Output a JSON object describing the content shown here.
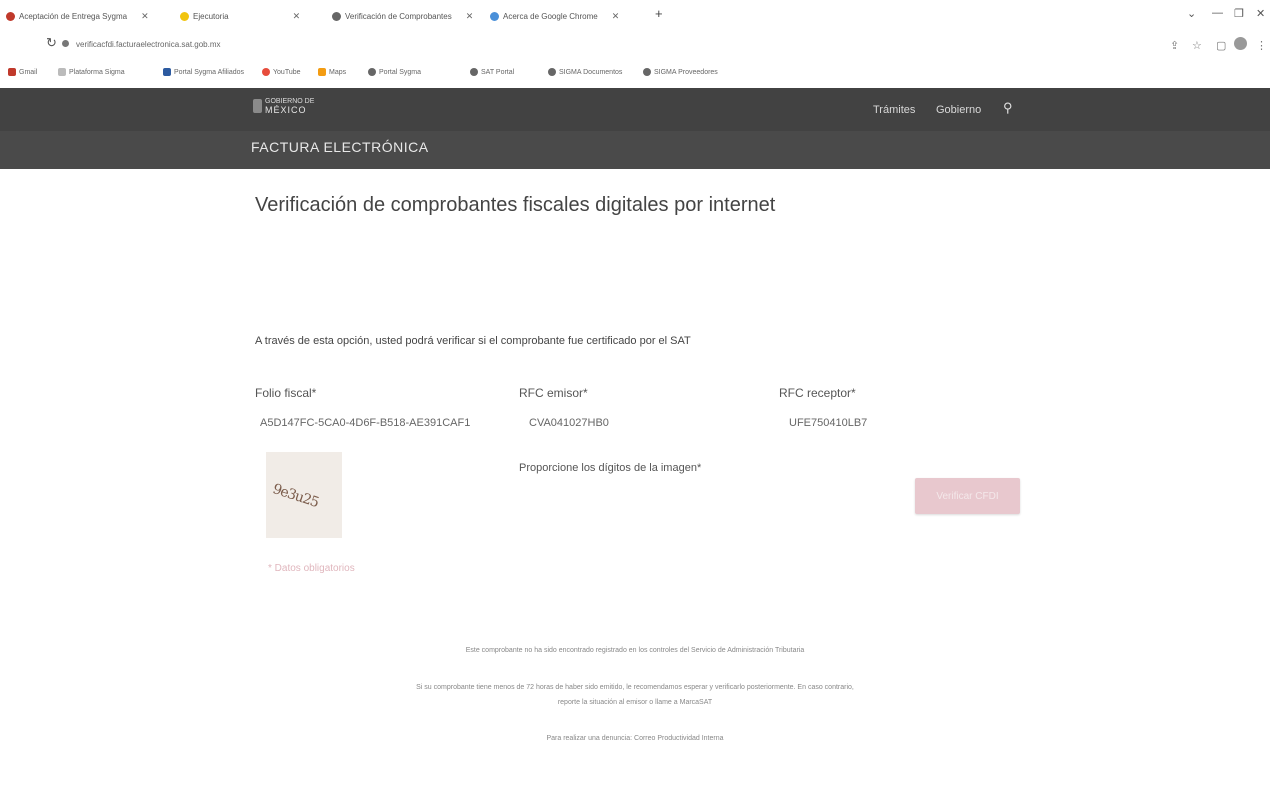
{
  "browser": {
    "tabs": [
      {
        "label": "Aceptación de Entrega Sygma",
        "close": "✕"
      },
      {
        "label": "Ejecutoria",
        "close": "✕"
      },
      {
        "label": "Verificación de Comprobantes",
        "close": "✕"
      },
      {
        "label": "Acerca de Google Chrome",
        "close": "✕"
      }
    ],
    "new_tab": "+",
    "window_controls": [
      "⌄",
      "—",
      "❐",
      "✕"
    ],
    "url": "verificacfdi.facturaelectronica.sat.gob.mx",
    "bookmarks": [
      {
        "label": "Gmail"
      },
      {
        "label": "Plataforma Sigma"
      },
      {
        "label": "Portal Sygma Afiliados"
      },
      {
        "label": "YouTube"
      },
      {
        "label": "Maps"
      },
      {
        "label": "Portal Sygma"
      },
      {
        "label": "SAT Portal"
      },
      {
        "label": "SIGMA Documentos"
      },
      {
        "label": "SIGMA Proveedores"
      }
    ]
  },
  "gov_header": {
    "logo_small": "GOBIERNO DE",
    "logo_main": "MÉXICO",
    "nav": [
      "Trámites",
      "Gobierno"
    ],
    "section_title": "FACTURA ELECTRÓNICA"
  },
  "main": {
    "title": "Verificación de comprobantes fiscales digitales por internet",
    "intro": "A través de esta opción, usted podrá verificar si el comprobante fue certificado por el SAT",
    "fields": [
      {
        "label": "Folio fiscal*",
        "value": "A5D147FC-5CA0-4D6F-B518-AE391CAF1"
      },
      {
        "label": "RFC emisor*",
        "value": "CVA041027HB0"
      },
      {
        "label": "RFC receptor*",
        "value": "UFE750410LB7"
      }
    ],
    "captcha_text": "9e3u25",
    "captcha_label": "Proporcione los dígitos de la imagen*",
    "verify_button": "Verificar CFDI",
    "required_note": "* Datos obligatorios"
  },
  "footer": {
    "line1": "Este comprobante no ha sido encontrado registrado en los controles del Servicio de Administración Tributaria",
    "line2a": "Si su comprobante tiene menos de 72 horas de haber sido emitido, le recomendamos esperar y verificarlo posteriormente. En caso contrario,",
    "line2b": "reporte la situación al emisor o llame a MarcaSAT",
    "line3": "Para realizar una denuncia: Correo Productividad Interna"
  },
  "colors": {
    "header_bg": "#424242",
    "button_bg": "#e8c8ce",
    "required_text": "#e0b6bd"
  }
}
